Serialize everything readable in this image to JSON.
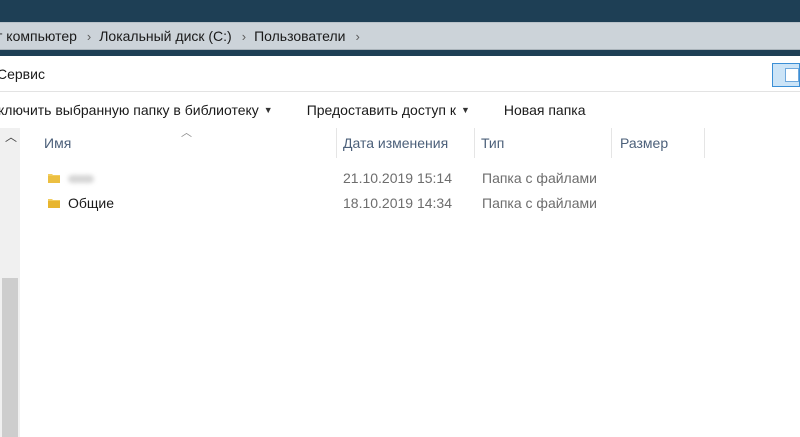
{
  "address": {
    "crumbs": [
      "т компьютер",
      "Локальный диск (C:)",
      "Пользователи"
    ]
  },
  "menu": {
    "service": "Сервис"
  },
  "toolbar": {
    "include": "ключить выбранную папку в библиотеку",
    "share": "Предоставить доступ к",
    "new_folder": "Новая папка"
  },
  "columns": {
    "name": "Имя",
    "date": "Дата изменения",
    "type": "Тип",
    "size": "Размер"
  },
  "files": [
    {
      "name": "",
      "date": "21.10.2019 15:14",
      "type": "Папка с файлами",
      "icon": "folder-icon"
    },
    {
      "name": "Общие",
      "date": "18.10.2019 14:34",
      "type": "Папка с файлами",
      "icon": "folder-icon"
    }
  ],
  "colors": {
    "titlebar": "#1e3f55",
    "address": "#ccd3d9",
    "folder": "#e8b52e",
    "header_text": "#4c607a"
  }
}
